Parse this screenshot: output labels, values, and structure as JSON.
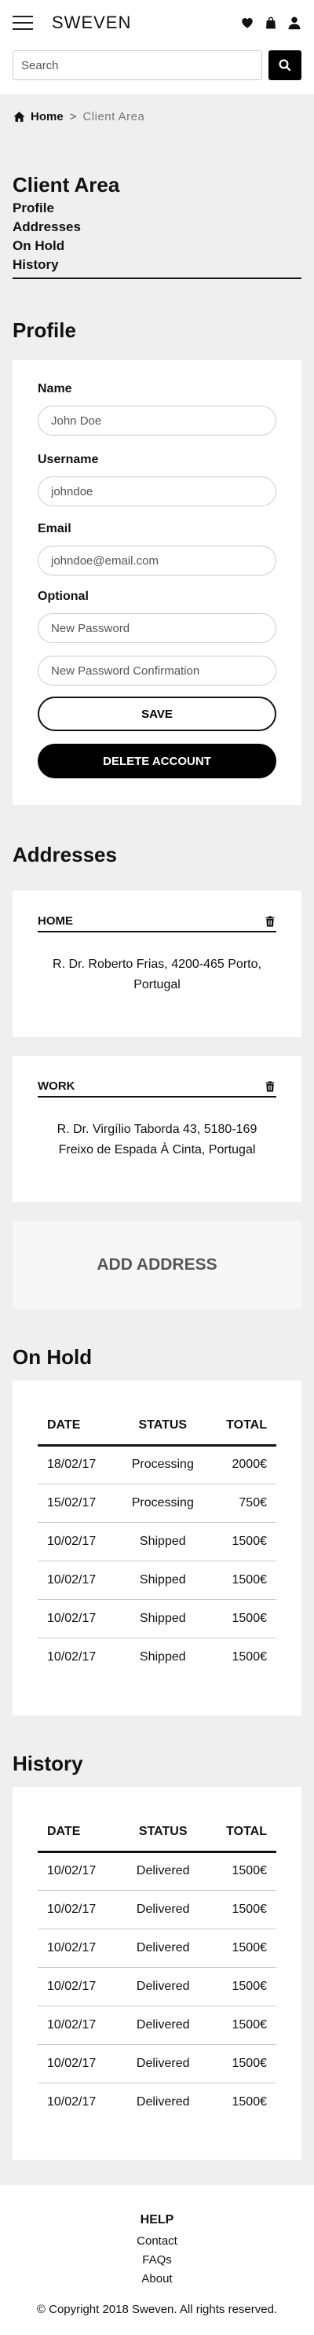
{
  "header": {
    "brand": "SWEVEN",
    "icons": [
      "menu-icon",
      "heart-icon",
      "bag-icon",
      "user-icon"
    ]
  },
  "search": {
    "placeholder": "Search",
    "button_icon": "search-icon"
  },
  "breadcrumb": {
    "home": "Home",
    "separator": ">",
    "current": "Client Area"
  },
  "client_area": {
    "title": "Client Area",
    "nav": [
      "Profile",
      "Addresses",
      "On Hold",
      "History"
    ]
  },
  "profile": {
    "title": "Profile",
    "name_label": "Name",
    "name_value": "John Doe",
    "username_label": "Username",
    "username_value": "johndoe",
    "email_label": "Email",
    "email_value": "johndoe@email.com",
    "optional_label": "Optional",
    "new_password_placeholder": "New Password",
    "confirm_password_placeholder": "New Password Confirmation",
    "save_label": "SAVE",
    "delete_label": "DELETE ACCOUNT"
  },
  "addresses": {
    "title": "Addresses",
    "items": [
      {
        "label": "HOME",
        "text": "R. Dr. Roberto Frias, 4200-465 Porto, Portugal"
      },
      {
        "label": "WORK",
        "text": "R. Dr. Virgílio Taborda 43, 5180-169 Freixo de Espada À Cinta, Portugal"
      }
    ],
    "add_label": "ADD ADDRESS"
  },
  "on_hold": {
    "title": "On Hold",
    "columns": [
      "DATE",
      "STATUS",
      "TOTAL"
    ],
    "rows": [
      [
        "18/02/17",
        "Processing",
        "2000€"
      ],
      [
        "15/02/17",
        "Processing",
        "750€"
      ],
      [
        "10/02/17",
        "Shipped",
        "1500€"
      ],
      [
        "10/02/17",
        "Shipped",
        "1500€"
      ],
      [
        "10/02/17",
        "Shipped",
        "1500€"
      ],
      [
        "10/02/17",
        "Shipped",
        "1500€"
      ]
    ]
  },
  "history": {
    "title": "History",
    "columns": [
      "DATE",
      "STATUS",
      "TOTAL"
    ],
    "rows": [
      [
        "10/02/17",
        "Delivered",
        "1500€"
      ],
      [
        "10/02/17",
        "Delivered",
        "1500€"
      ],
      [
        "10/02/17",
        "Delivered",
        "1500€"
      ],
      [
        "10/02/17",
        "Delivered",
        "1500€"
      ],
      [
        "10/02/17",
        "Delivered",
        "1500€"
      ],
      [
        "10/02/17",
        "Delivered",
        "1500€"
      ],
      [
        "10/02/17",
        "Delivered",
        "1500€"
      ]
    ]
  },
  "footer": {
    "help_title": "HELP",
    "links": [
      "Contact",
      "FAQs",
      "About"
    ],
    "copyright": "© Copyright 2018 Sweven. All rights reserved."
  }
}
